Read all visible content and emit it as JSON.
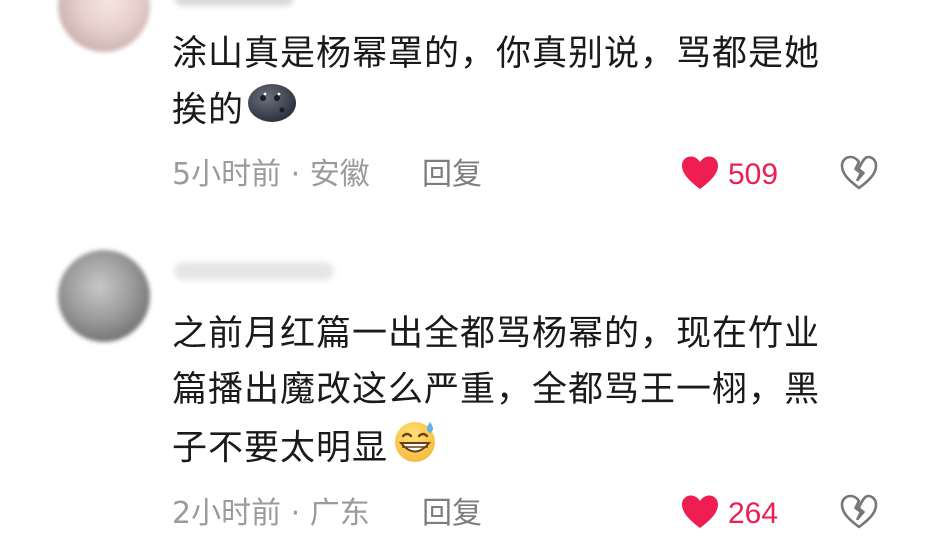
{
  "colors": {
    "like_red": "#ee1d52",
    "meta_gray": "#9b9b9b",
    "text_dark": "#1a1a1a"
  },
  "comments": [
    {
      "text_line1": "涂山真是杨幂罩的，你真别说，骂都是她",
      "text_line2": "挨的",
      "emoji": "new-moon-face-emoji",
      "time_location": "5小时前 · 安徽",
      "reply_label": "回复",
      "like_count": "509",
      "liked": true
    },
    {
      "text_line1": "之前月红篇一出全都骂杨幂的，现在竹业",
      "text_line2": "篇播出魔改这么严重，全都骂王一栩，黑",
      "text_line3": "子不要太明显",
      "emoji": "grinning-sweat-emoji",
      "time_location": "2小时前 · 广东",
      "reply_label": "回复",
      "like_count": "264",
      "liked": true
    }
  ]
}
